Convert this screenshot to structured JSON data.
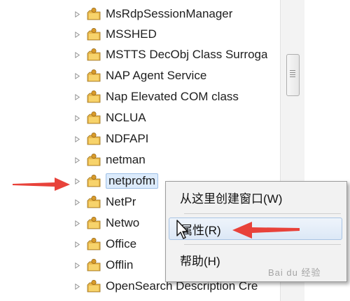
{
  "tree": {
    "items": [
      {
        "label": "MsRdpSessionManager"
      },
      {
        "label": "MSSHED"
      },
      {
        "label": "MSTTS DecObj Class Surroga"
      },
      {
        "label": "NAP Agent Service"
      },
      {
        "label": "Nap Elevated COM class"
      },
      {
        "label": "NCLUA"
      },
      {
        "label": "NDFAPI"
      },
      {
        "label": "netman"
      },
      {
        "label": "netprofm"
      },
      {
        "label": "NetPr"
      },
      {
        "label": "Netwo"
      },
      {
        "label": "Office"
      },
      {
        "label": "Offlin"
      },
      {
        "label": "OpenSearch Description Cre"
      }
    ],
    "selected_index": 8
  },
  "context_menu": {
    "items": [
      {
        "label": "从这里创建窗口(W)"
      },
      {
        "label": "属性(R)"
      },
      {
        "label": "帮助(H)"
      }
    ],
    "hover_index": 1
  },
  "annotation_color": "#e8423a",
  "icons": {
    "folder": "folder-icon",
    "expander": "expand-triangle-icon",
    "cursor": "mouse-cursor-icon",
    "arrow": "red-arrow-icon"
  },
  "watermark": "Bai du 经验"
}
